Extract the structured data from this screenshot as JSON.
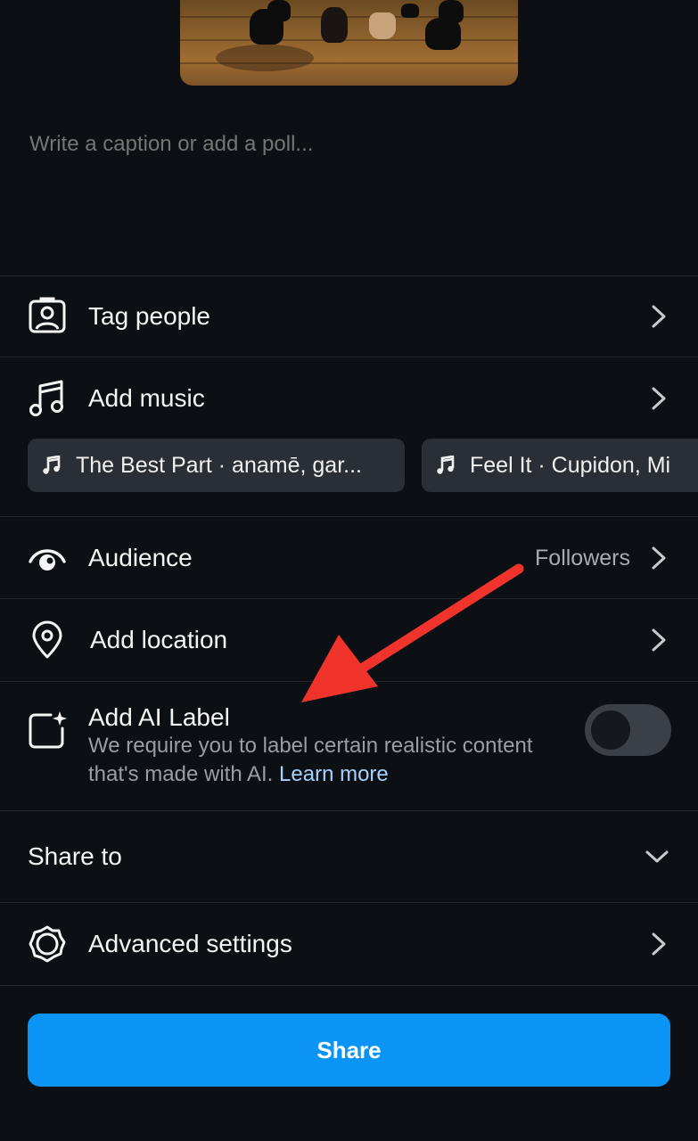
{
  "caption": {
    "placeholder": "Write a caption or add a poll..."
  },
  "rows": {
    "tag_people": {
      "label": "Tag people",
      "icon": "tag-person-icon"
    },
    "add_music": {
      "label": "Add music",
      "icon": "music-notes-icon"
    },
    "audience": {
      "label": "Audience",
      "value": "Followers",
      "icon": "eye-icon"
    },
    "add_location": {
      "label": "Add location",
      "icon": "location-pin-icon"
    },
    "ai_label": {
      "label": "Add AI Label",
      "description": "We require you to label certain realistic content that's made with AI.",
      "link": "Learn more",
      "enabled": false,
      "icon": "ai-sparkle-icon"
    },
    "share_to": {
      "label": "Share to",
      "icon": "chevron-down-icon"
    },
    "advanced": {
      "label": "Advanced settings",
      "icon": "settings-gear-icon"
    }
  },
  "music_suggestions": [
    {
      "text": "The Best Part · anamē, gar..."
    },
    {
      "text": "Feel It · Cupidon, Mi"
    }
  ],
  "share_button": {
    "label": "Share"
  },
  "colors": {
    "background": "#0c1014",
    "accent": "#0a95f6",
    "link": "#a3d2ff",
    "annotation_arrow": "#f0342c"
  }
}
